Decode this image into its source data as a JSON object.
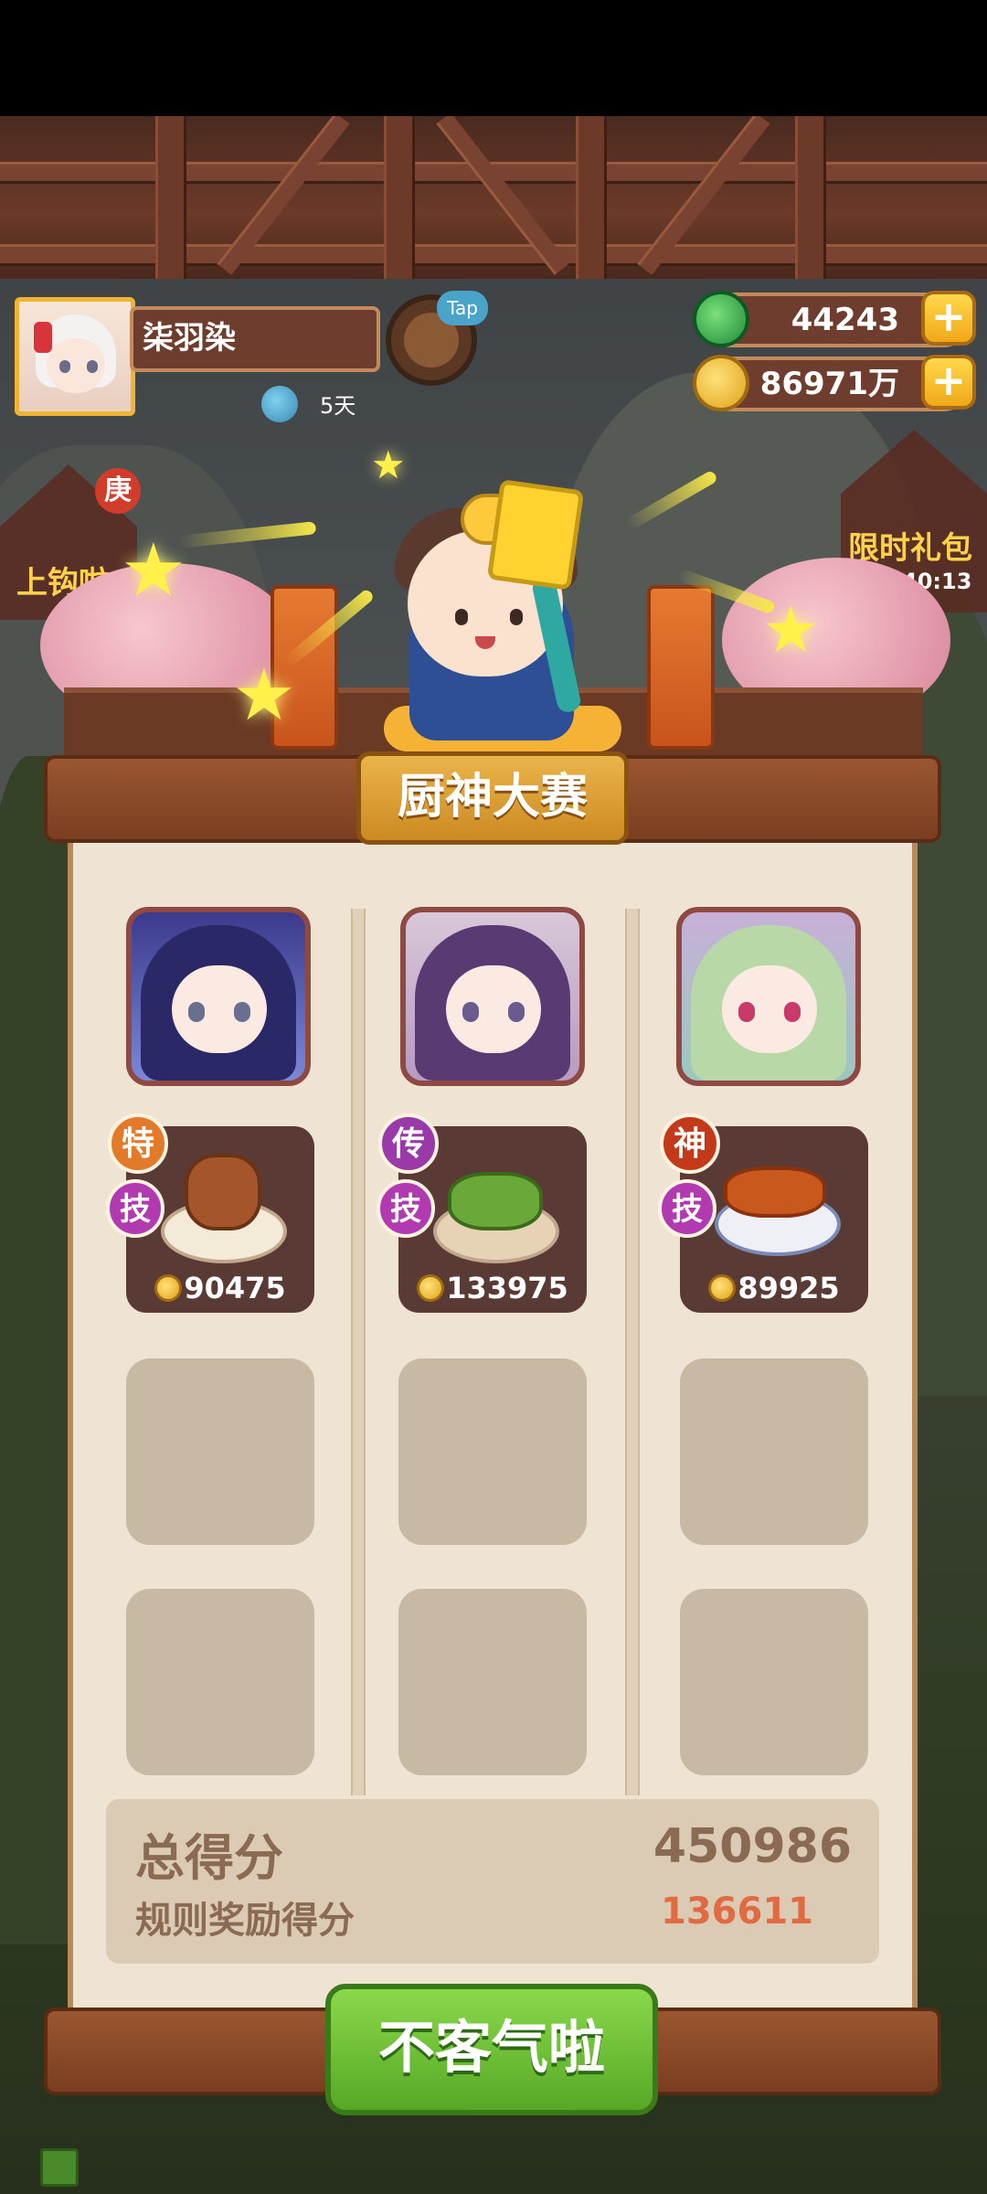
{
  "player": {
    "name": "柒羽染",
    "days_label": "5天",
    "tap_label": "Tap"
  },
  "resources": {
    "jade": "44243",
    "coins": "86971万",
    "plus_label": "+"
  },
  "side_events": {
    "left": {
      "label": "上钩啦",
      "badge": "庚"
    },
    "right": {
      "label": "限时礼包",
      "timer": "21:40:13"
    }
  },
  "contest": {
    "title": "厨神大赛",
    "chefs": [
      {
        "rank": "特",
        "skill": "技",
        "price": "90475",
        "rank_color": "#e27a2a",
        "dish": "pancake-dish"
      },
      {
        "rank": "传",
        "skill": "技",
        "price": "133975",
        "rank_color": "#9a3aa8",
        "dish": "spring-roll-dish"
      },
      {
        "rank": "神",
        "skill": "技",
        "price": "89925",
        "rank_color": "#c23a1a",
        "dish": "braised-pork-dish"
      }
    ],
    "total_label": "总得分",
    "total_value": "450986",
    "bonus_label": "规则奖励得分",
    "bonus_value": "136611",
    "confirm_label": "不客气啦"
  },
  "colors": {
    "accent_gold": "#f0b432",
    "button_green": "#56a826",
    "bonus_orange": "#e06a42"
  }
}
